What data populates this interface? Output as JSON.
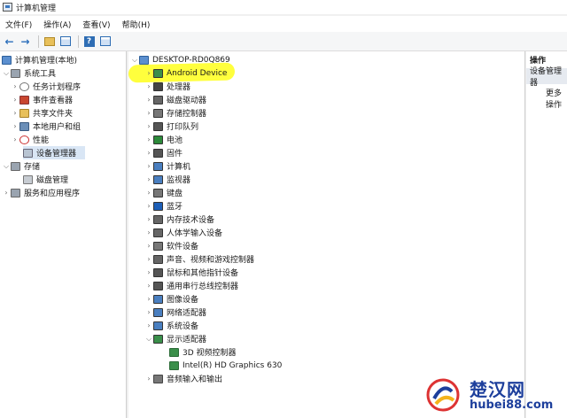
{
  "window": {
    "title": "计算机管理"
  },
  "menu": [
    "文件(F)",
    "操作(A)",
    "查看(V)",
    "帮助(H)"
  ],
  "toolbar": {
    "buttons": [
      "back-icon",
      "forward-icon",
      "up-folder-icon",
      "show-hide-tree-icon",
      "help-icon",
      "properties-icon"
    ]
  },
  "left_tree": {
    "root": "计算机管理(本地)",
    "system_tools": "系统工具",
    "items": [
      "任务计划程序",
      "事件查看器",
      "共享文件夹",
      "本地用户和组",
      "性能",
      "设备管理器"
    ],
    "storage": "存储",
    "storage_items": [
      "磁盘管理"
    ],
    "services": "服务和应用程序",
    "selected": "设备管理器"
  },
  "device_tree": {
    "computer": "DESKTOP-RD0Q869",
    "categories": [
      "Android Device",
      "处理器",
      "磁盘驱动器",
      "存储控制器",
      "打印队列",
      "电池",
      "固件",
      "计算机",
      "监视器",
      "键盘",
      "蓝牙",
      "内存技术设备",
      "人体学输入设备",
      "软件设备",
      "声音、视频和游戏控制器",
      "鼠标和其他指针设备",
      "通用串行总线控制器",
      "图像设备",
      "网络适配器",
      "系统设备",
      "显示适配器"
    ],
    "expanded": "显示适配器",
    "display_adapters": [
      "3D 视频控制器",
      "Intel(R) HD Graphics 630"
    ],
    "last": "音频输入和输出",
    "highlighted": "Android Device"
  },
  "actions": {
    "header": "操作",
    "section": "设备管理器",
    "more": "更多操作"
  },
  "watermark": {
    "name": "楚汉网",
    "url": "hubei88.com"
  }
}
